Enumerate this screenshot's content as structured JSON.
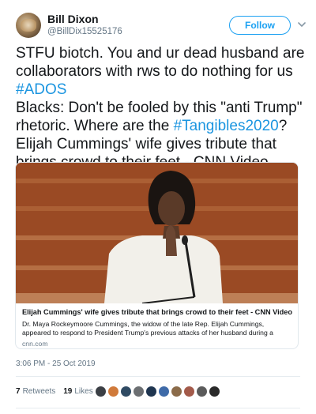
{
  "user": {
    "name": "Bill Dixon",
    "handle": "@BillDix15525176"
  },
  "header": {
    "follow_label": "Follow"
  },
  "tweet": {
    "lines": [
      {
        "text": "STFU biotch. You and ur dead husband are"
      },
      {
        "text": "collaborators with rws to do nothing for us"
      },
      {
        "hashtag": "#ADOS"
      },
      {
        "text": "Blacks: Don't be fooled by this \"anti Trump\""
      },
      {
        "text": "rhetoric. Where are the ",
        "hashtag": "#Tangibles2020",
        "after": "?"
      },
      {
        "text": "Elijah Cummings' wife gives tribute that"
      },
      {
        "text": "brings crowd to their feet - CNN Video"
      }
    ]
  },
  "card": {
    "title": "Elijah Cummings' wife gives tribute that brings crowd to their feet - CNN Video",
    "description_lines": [
      "Dr. Maya Rockeymoore Cummings, the widow of the late Rep. Elijah Cummings,",
      "appeared to respond to President Trump's previous attacks of her husband during a"
    ],
    "domain": "cnn.com"
  },
  "meta": {
    "timestamp": "3:06 PM - 25 Oct 2019",
    "retweets_count": "7",
    "retweets_label": "Retweets",
    "likes_count": "19",
    "likes_label": "Likes"
  },
  "colors": {
    "accent": "#1da1f2",
    "hashtag": "#1b95e0",
    "muted": "#657786"
  },
  "liker_avatars": [
    "#3b3f45",
    "#d07a3a",
    "#2f4a63",
    "#6c6f72",
    "#1f3550",
    "#3e6aa8",
    "#8b6b4a",
    "#a35a4a",
    "#5b5b5b",
    "#2a2a2a"
  ]
}
